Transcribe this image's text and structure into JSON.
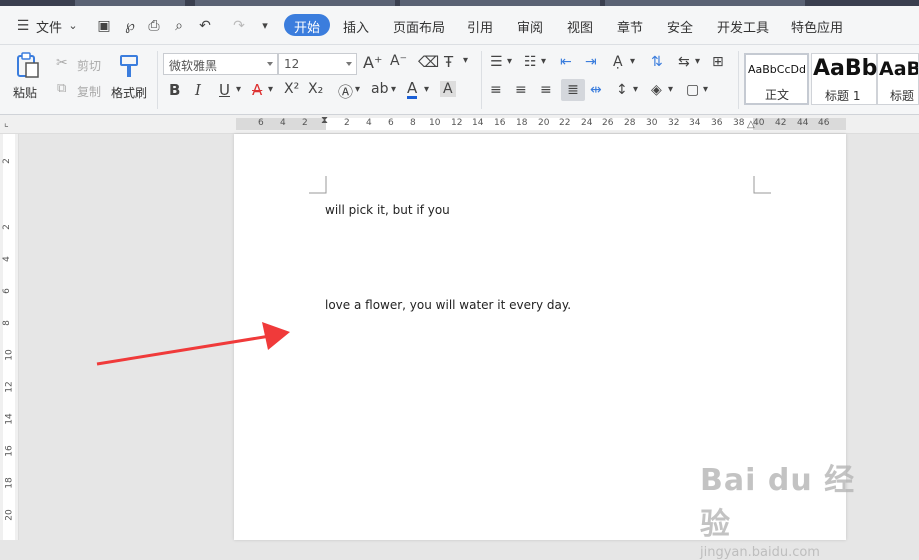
{
  "menubar": {
    "file_label": "文件",
    "tabs": [
      "开始",
      "插入",
      "页面布局",
      "引用",
      "审阅",
      "视图",
      "章节",
      "安全",
      "开发工具",
      "特色应用"
    ],
    "active_tab": "开始"
  },
  "toolbar": {
    "paste_label": "粘贴",
    "cut_label": "剪切",
    "copy_label": "复制",
    "format_painter_label": "格式刷",
    "font_name": "微软雅黑",
    "font_size": "12",
    "styles": [
      {
        "preview": "AaBbCcDd",
        "name": "正文"
      },
      {
        "preview": "AaBb",
        "name": "标题 1"
      },
      {
        "preview": "AaB",
        "name": "标题"
      }
    ]
  },
  "ruler": {
    "h_ticks": [
      "6",
      "4",
      "2",
      "2",
      "4",
      "6",
      "8",
      "10",
      "12",
      "14",
      "16",
      "18",
      "20",
      "22",
      "24",
      "26",
      "28",
      "30",
      "32",
      "34",
      "36",
      "38",
      "40",
      "42",
      "44",
      "46"
    ],
    "v_ticks": [
      "2",
      "2",
      "4",
      "6",
      "8",
      "10",
      "12",
      "14",
      "16",
      "18",
      "20"
    ]
  },
  "document": {
    "paragraphs": [
      "will pick it, but if you",
      "love a flower, you will water it every day."
    ]
  },
  "annotation": {
    "arrow_color": "#f03a3a"
  },
  "watermark": {
    "brand": "Bai du 经验",
    "url": "jingyan.baidu.com"
  },
  "colors": {
    "accent": "#3b7ddd",
    "font_color_underline": "#1a5fd6"
  }
}
